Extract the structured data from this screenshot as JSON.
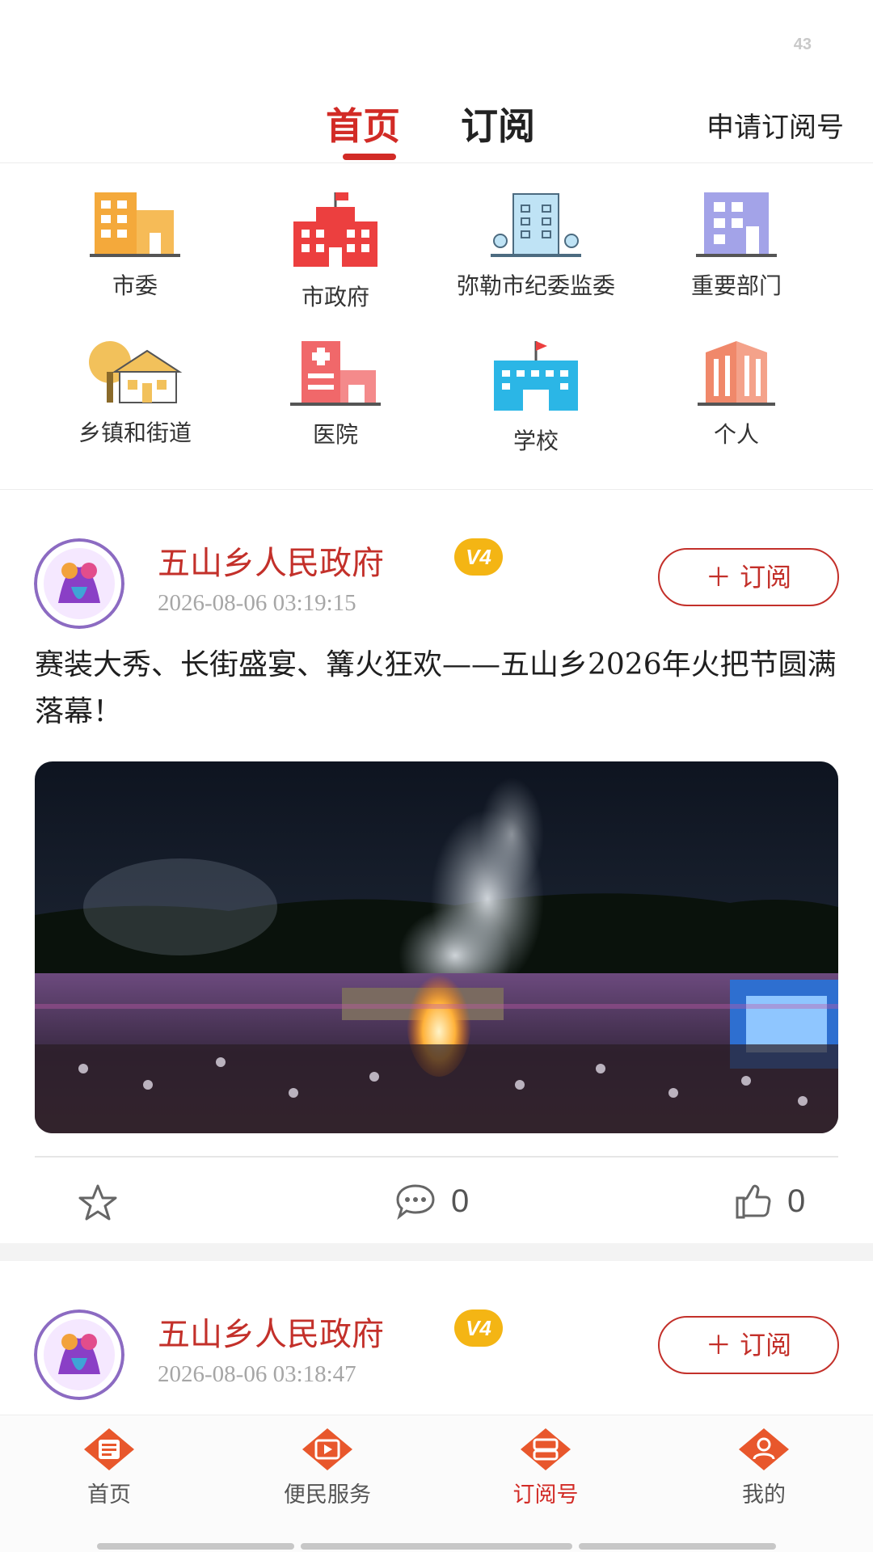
{
  "status_bar": {
    "number": "43"
  },
  "header": {
    "tabs": [
      {
        "label": "首页",
        "active": true
      },
      {
        "label": "订阅",
        "active": false
      }
    ],
    "apply_label": "申请订阅号"
  },
  "categories": [
    {
      "label": "市委",
      "icon": "building-icon",
      "color": "#f4a93b"
    },
    {
      "label": "市政府",
      "icon": "government-building-icon",
      "color": "#ec3f3f"
    },
    {
      "label": "弥勒市纪委监委",
      "icon": "office-tower-icon",
      "color": "#9fd3ee"
    },
    {
      "label": "重要部门",
      "icon": "department-building-icon",
      "color": "#a3a3e8"
    },
    {
      "label": "乡镇和街道",
      "icon": "town-house-icon",
      "color": "#f2c15b"
    },
    {
      "label": "医院",
      "icon": "hospital-icon",
      "color": "#f0686a"
    },
    {
      "label": "学校",
      "icon": "school-icon",
      "color": "#2bb6e6"
    },
    {
      "label": "个人",
      "icon": "residential-tower-icon",
      "color": "#f0886a"
    }
  ],
  "posts": [
    {
      "author": "五山乡人民政府",
      "badge": "V4",
      "time": "2026-08-06 03:19:15",
      "subscribe_label": "＋ 订阅",
      "title": "赛装大秀、长街盛宴、篝火狂欢——五山乡2026年火把节圆满落幕！",
      "comments": "0",
      "likes": "0"
    },
    {
      "author": "五山乡人民政府",
      "badge": "V4",
      "time": "2026-08-06 03:18:47",
      "subscribe_label": "＋ 订阅"
    }
  ],
  "bottom_nav": [
    {
      "label": "首页",
      "icon": "news-icon",
      "active": false
    },
    {
      "label": "便民服务",
      "icon": "play-icon",
      "active": false
    },
    {
      "label": "订阅号",
      "icon": "subscription-icon",
      "active": true
    },
    {
      "label": "我的",
      "icon": "profile-icon",
      "active": false
    }
  ],
  "colors": {
    "accent": "#d22b26",
    "author": "#c3302a",
    "badge": "#f4b514"
  }
}
